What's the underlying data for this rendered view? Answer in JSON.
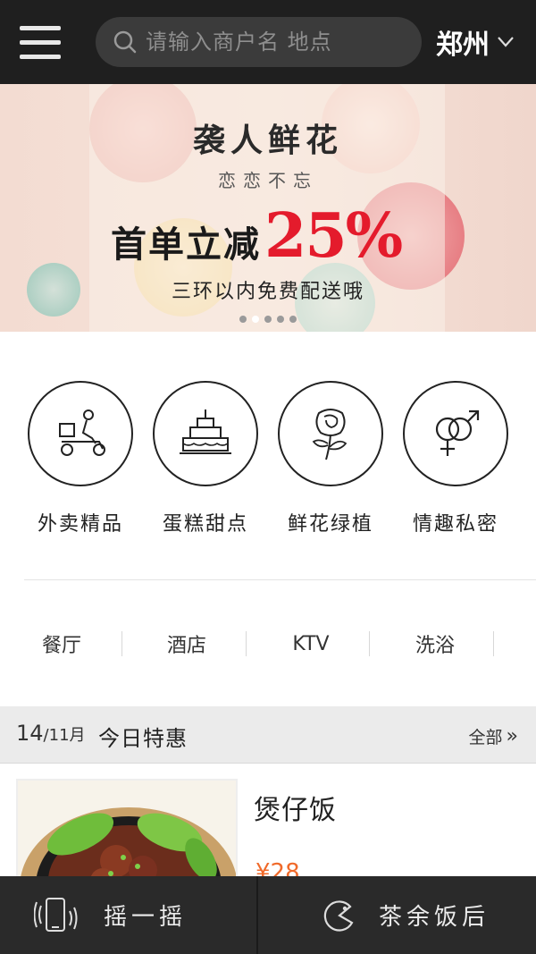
{
  "header": {
    "menu_icon": "hamburger-menu-icon",
    "search": {
      "placeholder": "请输入商户名 地点",
      "icon": "search-icon"
    },
    "city": "郑州",
    "city_icon": "chevron-down-icon"
  },
  "banner": {
    "title": "袭人鲜花",
    "subtitle": "恋恋不忘",
    "promo_text": "首单立减",
    "promo_percent": "25%",
    "footer": "三环以内免费配送哦",
    "slide_count": 5,
    "active_slide": 2,
    "accent_color": "#e41b2c"
  },
  "categories": [
    {
      "label": "外卖精品",
      "icon": "delivery-scooter-icon"
    },
    {
      "label": "蛋糕甜点",
      "icon": "cake-icon"
    },
    {
      "label": "鲜花绿植",
      "icon": "rose-icon"
    },
    {
      "label": "情趣私密",
      "icon": "gender-symbols-icon"
    }
  ],
  "tabs": [
    "餐厅",
    "酒店",
    "KTV",
    "洗浴"
  ],
  "deals": {
    "date_day": "14",
    "date_month": "/11月",
    "title": "今日特惠",
    "all_label": "全部",
    "all_icon": "double-chevron-right-icon",
    "items": [
      {
        "name": "煲仔饭",
        "price": "¥28",
        "image": "clay-pot-rice-photo"
      }
    ],
    "price_color": "#f06a2a"
  },
  "bottom_bar": {
    "shake": {
      "label": "摇一摇",
      "icon": "phone-shake-icon"
    },
    "leisure": {
      "label": "茶余饭后",
      "icon": "pacman-icon"
    }
  }
}
